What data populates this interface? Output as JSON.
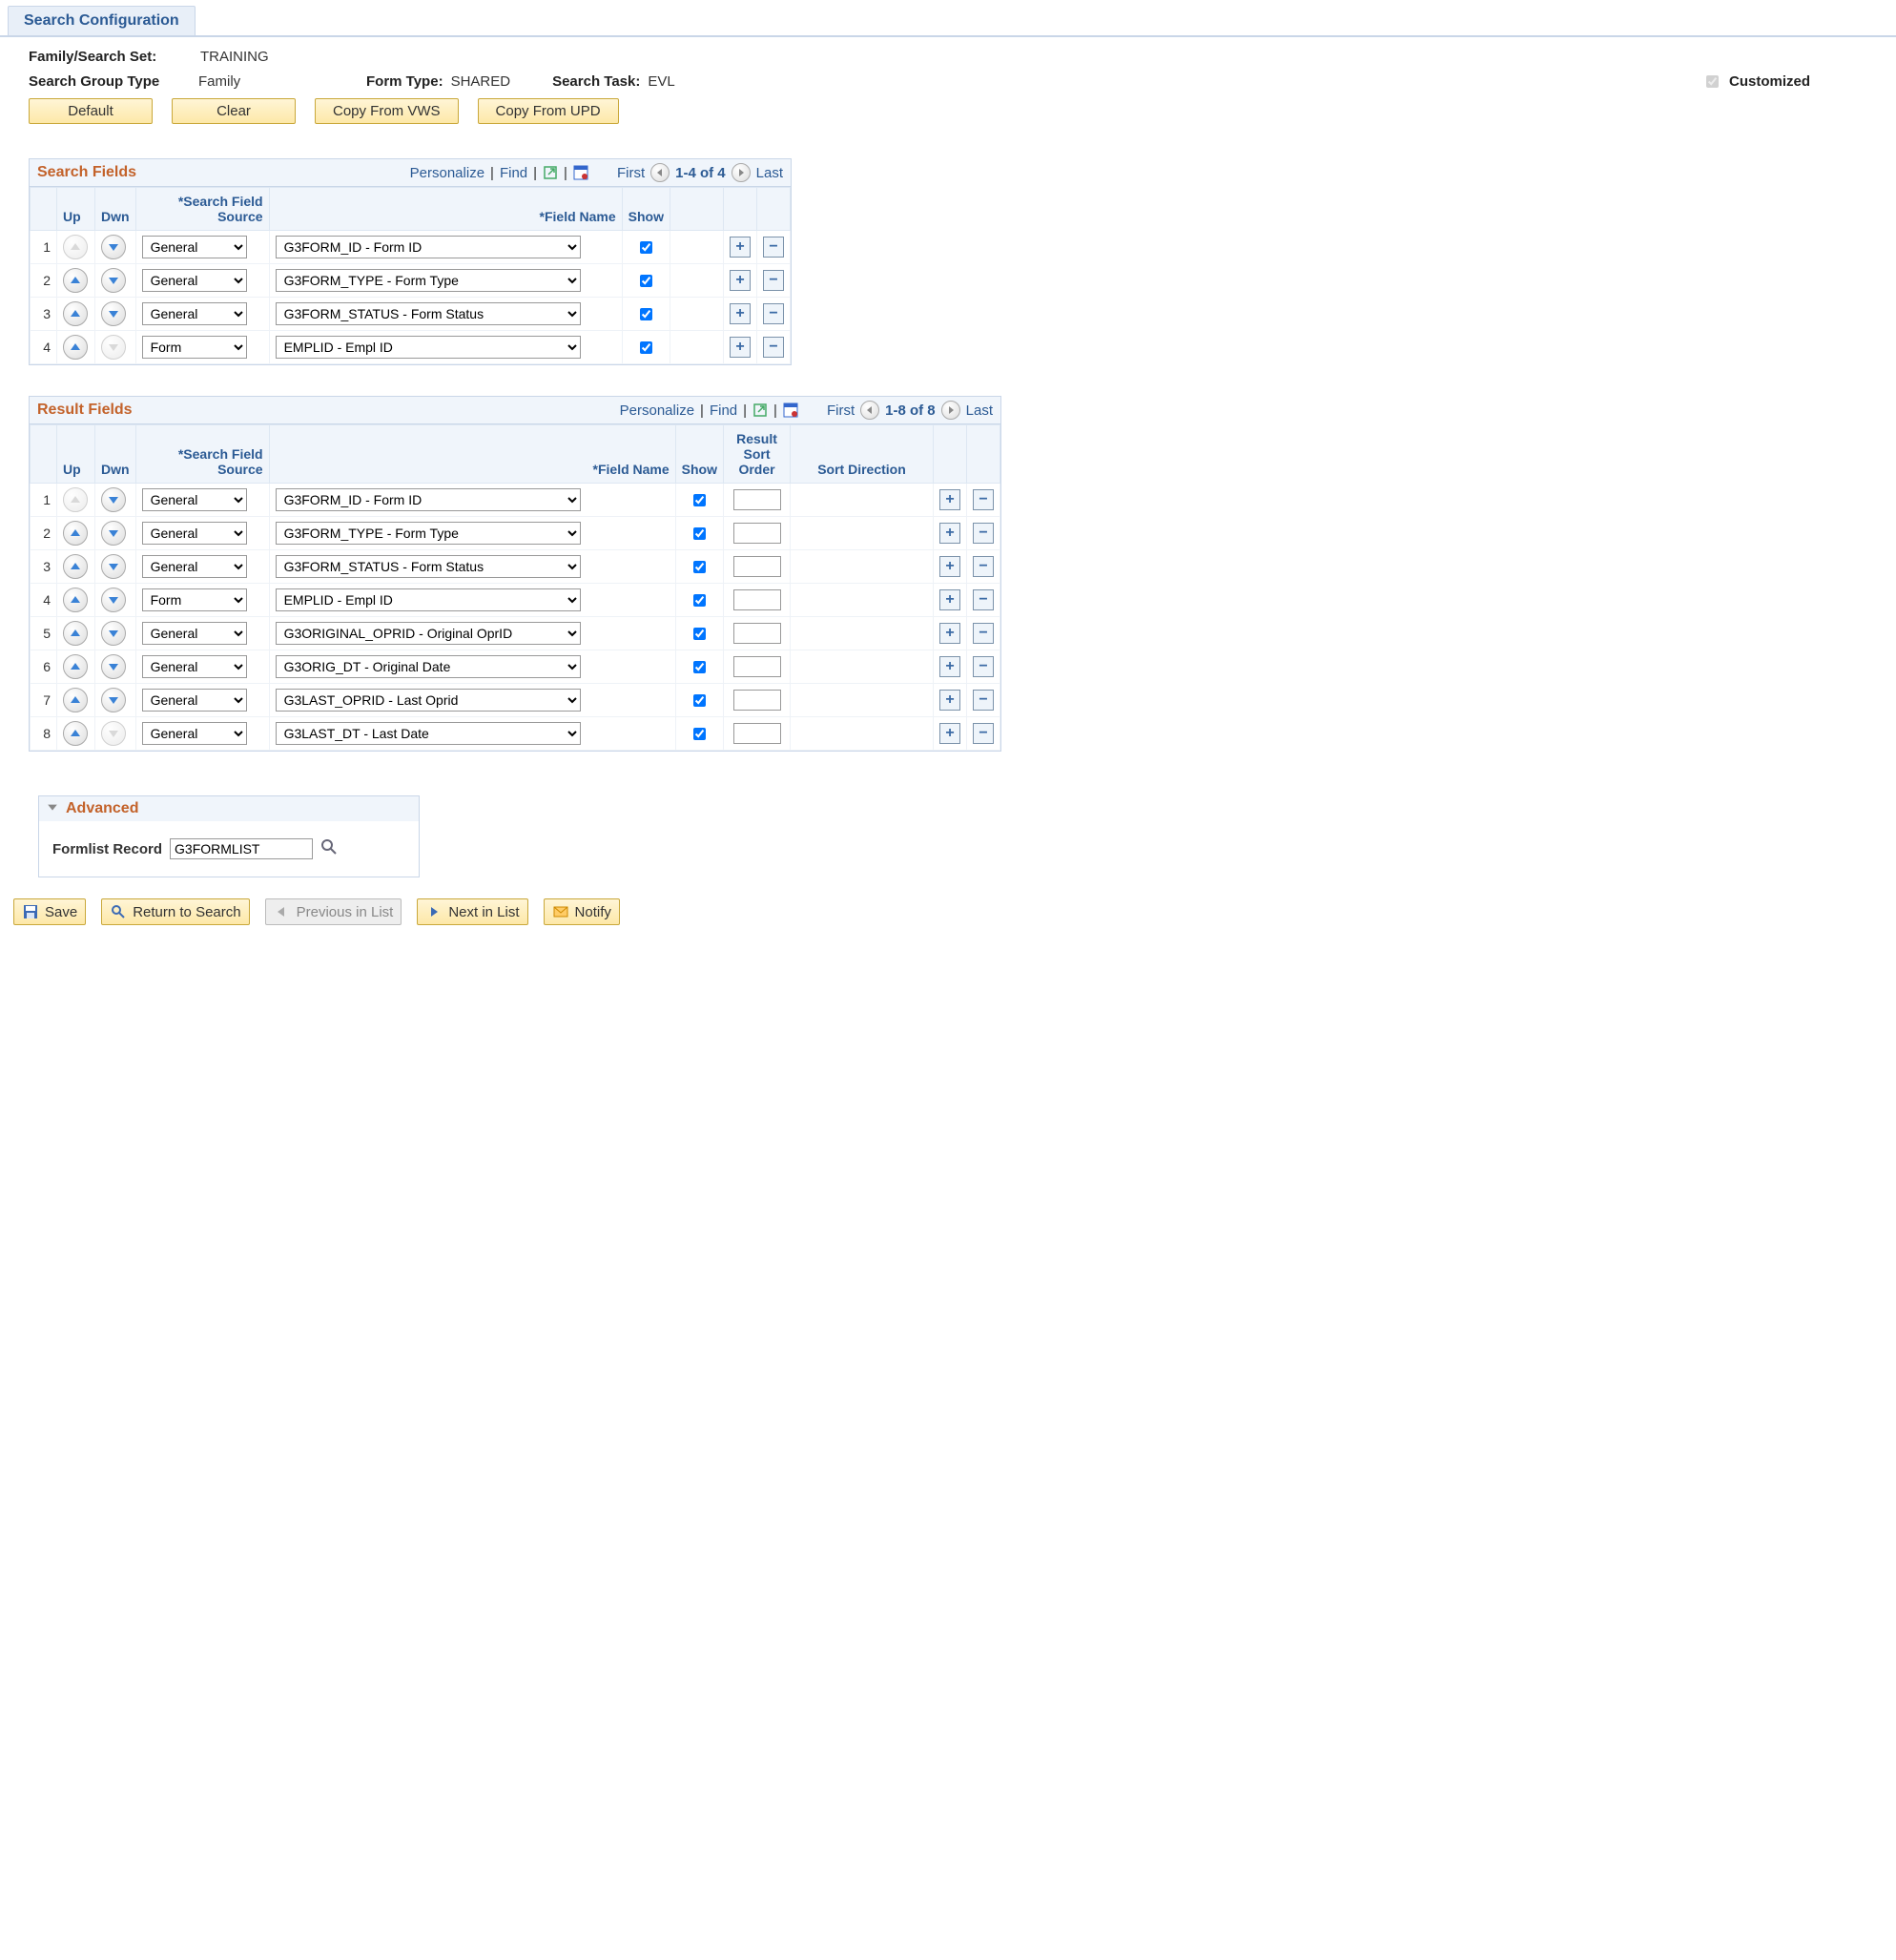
{
  "tab_label": "Search Configuration",
  "labels": {
    "family_search_set": "Family/Search Set:",
    "search_group_type": "Search Group Type",
    "form_type": "Form Type:",
    "search_task": "Search Task:",
    "customized": "Customized"
  },
  "values": {
    "family_search_set": "TRAINING",
    "search_group_type": "Family",
    "form_type": "SHARED",
    "search_task": "EVL",
    "customized_checked": true
  },
  "buttons": {
    "default": "Default",
    "clear": "Clear",
    "copy_from_vws": "Copy From VWS",
    "copy_from_upd": "Copy From UPD"
  },
  "grid_common": {
    "personalize": "Personalize",
    "find": "Find",
    "first": "First",
    "last": "Last",
    "sep": "|"
  },
  "search_fields": {
    "title": "Search Fields",
    "range": "1-4 of 4",
    "cols": {
      "up": "Up",
      "dwn": "Dwn",
      "source": "*Search Field Source",
      "field_name": "*Field Name",
      "show": "Show"
    },
    "rows": [
      {
        "n": "1",
        "up_disabled": true,
        "dwn_disabled": false,
        "source": "General",
        "field": "G3FORM_ID - Form ID",
        "show": true
      },
      {
        "n": "2",
        "up_disabled": false,
        "dwn_disabled": false,
        "source": "General",
        "field": "G3FORM_TYPE - Form Type",
        "show": true
      },
      {
        "n": "3",
        "up_disabled": false,
        "dwn_disabled": false,
        "source": "General",
        "field": "G3FORM_STATUS - Form Status",
        "show": true
      },
      {
        "n": "4",
        "up_disabled": false,
        "dwn_disabled": true,
        "source": "Form",
        "field": "EMPLID - Empl ID",
        "show": true
      }
    ]
  },
  "result_fields": {
    "title": "Result Fields",
    "range": "1-8 of 8",
    "cols": {
      "up": "Up",
      "dwn": "Dwn",
      "source": "*Search Field Source",
      "field_name": "*Field Name",
      "show": "Show",
      "sort_order": "Result Sort Order",
      "sort_dir": "Sort Direction"
    },
    "rows": [
      {
        "n": "1",
        "up_disabled": true,
        "dwn_disabled": false,
        "source": "General",
        "field": "G3FORM_ID - Form ID",
        "show": true,
        "sort_order": "",
        "sort_dir": ""
      },
      {
        "n": "2",
        "up_disabled": false,
        "dwn_disabled": false,
        "source": "General",
        "field": "G3FORM_TYPE - Form Type",
        "show": true,
        "sort_order": "",
        "sort_dir": ""
      },
      {
        "n": "3",
        "up_disabled": false,
        "dwn_disabled": false,
        "source": "General",
        "field": "G3FORM_STATUS - Form Status",
        "show": true,
        "sort_order": "",
        "sort_dir": ""
      },
      {
        "n": "4",
        "up_disabled": false,
        "dwn_disabled": false,
        "source": "Form",
        "field": "EMPLID - Empl ID",
        "show": true,
        "sort_order": "",
        "sort_dir": ""
      },
      {
        "n": "5",
        "up_disabled": false,
        "dwn_disabled": false,
        "source": "General",
        "field": "G3ORIGINAL_OPRID - Original OprID",
        "show": true,
        "sort_order": "",
        "sort_dir": ""
      },
      {
        "n": "6",
        "up_disabled": false,
        "dwn_disabled": false,
        "source": "General",
        "field": "G3ORIG_DT - Original Date",
        "show": true,
        "sort_order": "",
        "sort_dir": ""
      },
      {
        "n": "7",
        "up_disabled": false,
        "dwn_disabled": false,
        "source": "General",
        "field": "G3LAST_OPRID - Last Oprid",
        "show": true,
        "sort_order": "",
        "sort_dir": ""
      },
      {
        "n": "8",
        "up_disabled": false,
        "dwn_disabled": true,
        "source": "General",
        "field": "G3LAST_DT - Last Date",
        "show": true,
        "sort_order": "",
        "sort_dir": ""
      }
    ]
  },
  "advanced": {
    "title": "Advanced",
    "formlist_label": "Formlist Record",
    "formlist_value": "G3FORMLIST"
  },
  "footer": {
    "save": "Save",
    "return": "Return to Search",
    "prev": "Previous in List",
    "next": "Next in List",
    "notify": "Notify"
  }
}
